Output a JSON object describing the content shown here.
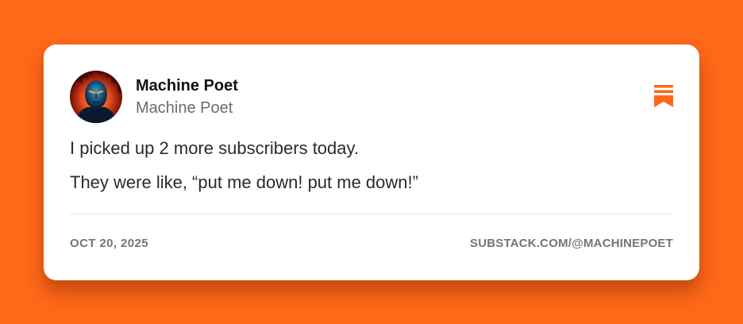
{
  "post": {
    "author_name": "Machine Poet",
    "author_handle": "Machine Poet",
    "lines": [
      "I picked up 2 more subscribers today.",
      "They were like, “put me down! put me down!”"
    ],
    "date": "OCT 20, 2025",
    "url": "SUBSTACK.COM/@MACHINEPOET"
  },
  "icons": {
    "brand": "substack-bookmark-icon",
    "avatar": "avatar"
  },
  "colors": {
    "background": "#FF6719",
    "brand": "#FF6719",
    "card": "#FFFFFF",
    "text": "#2B2B2B",
    "muted": "#757575"
  }
}
